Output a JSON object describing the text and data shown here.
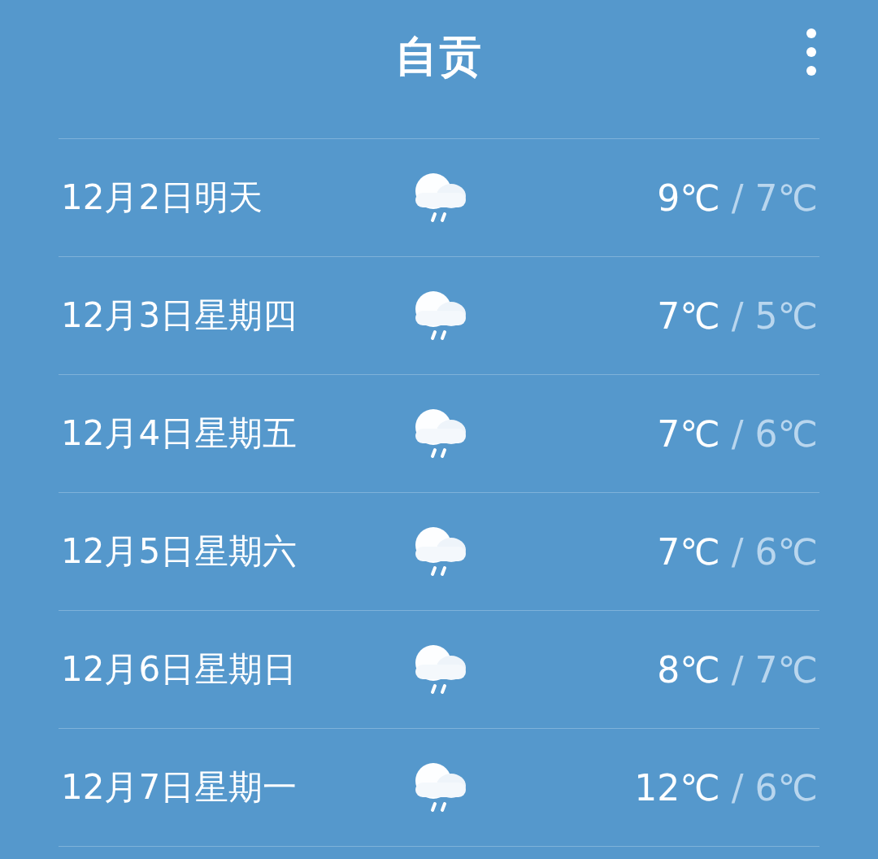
{
  "header": {
    "title": "自贡"
  },
  "days": [
    {
      "date": "12月2日明天",
      "high": "9℃",
      "separator": "/",
      "low": "7℃"
    },
    {
      "date": "12月3日星期四",
      "high": "7℃",
      "separator": "/",
      "low": "5℃"
    },
    {
      "date": "12月4日星期五",
      "high": "7℃",
      "separator": "/",
      "low": "6℃"
    },
    {
      "date": "12月5日星期六",
      "high": "7℃",
      "separator": "/",
      "low": "6℃"
    },
    {
      "date": "12月6日星期日",
      "high": "8℃",
      "separator": "/",
      "low": "7℃"
    },
    {
      "date": "12月7日星期一",
      "high": "12℃",
      "separator": "/",
      "low": "6℃"
    }
  ]
}
